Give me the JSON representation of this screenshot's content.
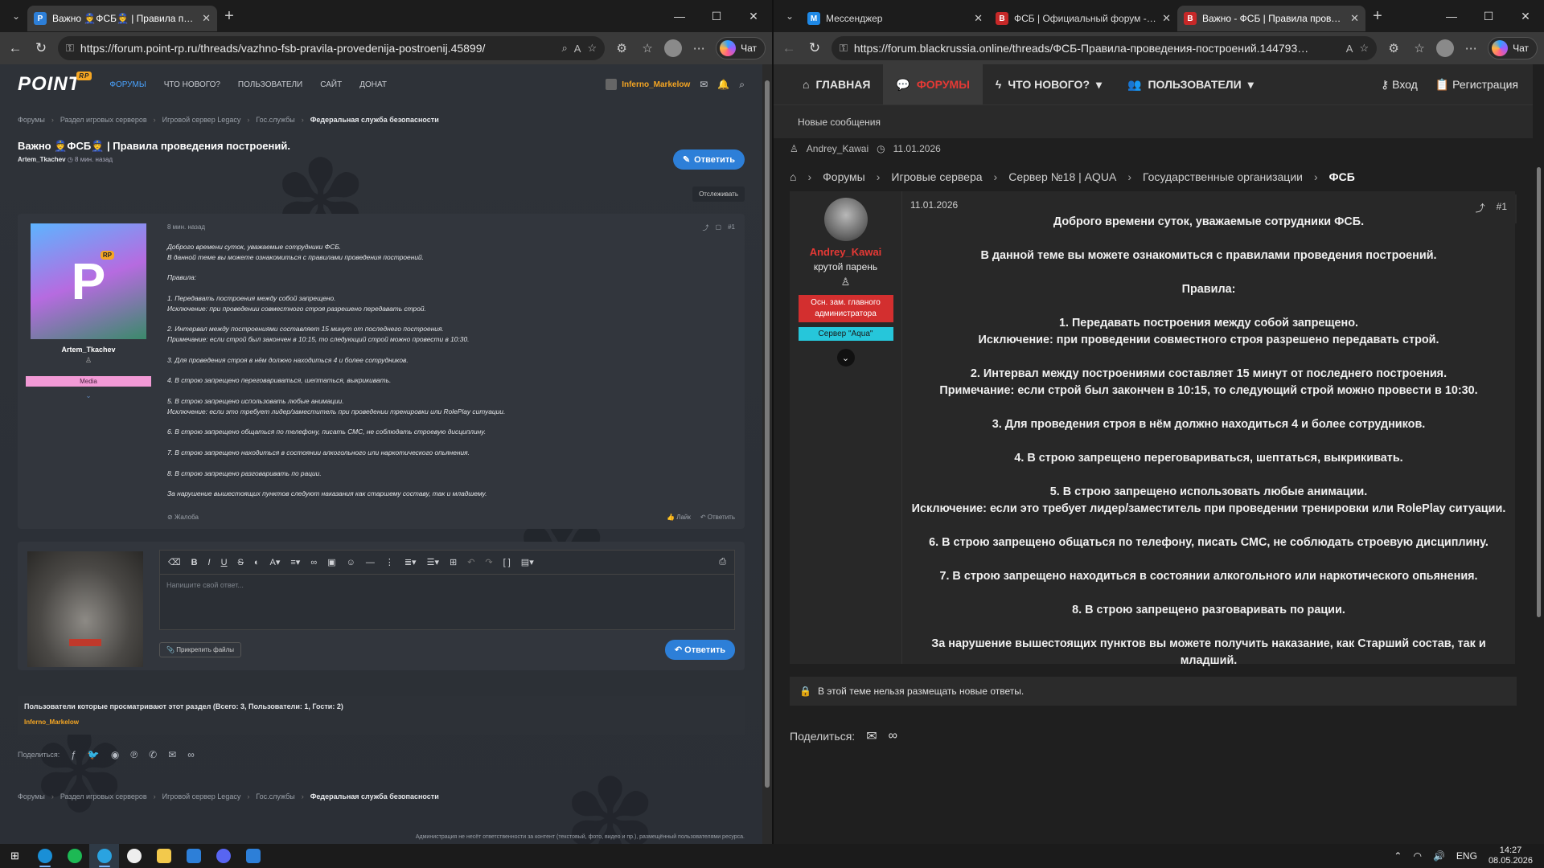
{
  "left_browser": {
    "tabs": [
      {
        "title": "Важно 👮ФСБ👮 | Правила прове…",
        "favicon": "P",
        "color": "#2d7fd8",
        "active": true
      }
    ],
    "new_tab_icon": "plus-icon",
    "url": "https://forum.point-rp.ru/threads/vazhno-fsb-pravila-provedenija-postroenij.45899/",
    "copilot_label": "Чат"
  },
  "left_site": {
    "logo": "POINT",
    "logo_badge": "RP",
    "nav": [
      "ФОРУМЫ",
      "ЧТО НОВОГО?",
      "ПОЛЬЗОВАТЕЛИ",
      "САЙТ",
      "ДОНАТ"
    ],
    "current_user": "Inferno_Markelow",
    "breadcrumbs": [
      "Форумы",
      "Раздел игровых серверов",
      "Игровой сервер Legacy",
      "Гос.службы",
      "Федеральная служба безопасности"
    ],
    "thread_title": "Важно 👮ФСБ👮 | Правила проведения построений.",
    "thread_author": "Artem_Tkachev",
    "thread_time": "8 мин. назад",
    "reply_button": "Ответить",
    "watch_button": "Отслеживать",
    "post": {
      "author": "Artem_Tkachev",
      "avatar_letter": "P",
      "avatar_badge": "RP",
      "badge": "Media",
      "date": "8 мин. назад",
      "number": "#1",
      "lines": [
        "Доброго времени суток, уважаемые сотрудники ФСБ.",
        "В данной теме вы можете ознакомиться с правилами проведения построений.",
        "",
        "Правила:",
        "",
        "1. Передавать построения между собой запрещено.",
        "Исключение: при проведении совместного строя разрешено передавать строй.",
        "",
        "2. Интервал между построениями составляет 15 минут от последнего построения.",
        "Примечание: если строй был закончен в 10:15, то следующий строй можно провести в 10:30.",
        "",
        "3. Для проведения строя в нём должно находиться 4 и более сотрудников.",
        "",
        "4. В строю запрещено переговариваться, шептаться, выкрикивать.",
        "",
        "5. В строю запрещено использовать любые анимации.",
        "Исключение: если это требует лидер/заместитель при проведении тренировки или RolePlay ситуации.",
        "",
        "6. В строю запрещено общаться по телефону, писать СМС, не соблюдать строевую дисциплину.",
        "",
        "7. В строю запрещено находиться в состоянии алкогольного или наркотического опьянения.",
        "",
        "8. В строю запрещено разговаривать по рации.",
        "",
        "За нарушение вышестоящих пунктов следуют наказания как старшему составу, так и младшему."
      ],
      "report": "Жалоба",
      "like": "Лайк",
      "reply": "Ответить"
    },
    "editor": {
      "placeholder": "Напишите свой ответ...",
      "attach": "Прикрепить файлы",
      "submit": "Ответить"
    },
    "viewers_title": "Пользователи которые просматривают этот раздел (Всего: 3, Пользователи: 1, Гости: 2)",
    "viewers_user": "Inferno_Markelow",
    "share_label": "Поделиться:",
    "disclaimer": "Администрация не несёт ответственности за контент (текстовый, фото, видео и пр.), размещённый пользователями ресурса."
  },
  "right_browser": {
    "tabs": [
      {
        "title": "Мессенджер",
        "favicon": "M",
        "color": "#1e88e5",
        "active": false
      },
      {
        "title": "ФСБ | Официальный форум - Bl…",
        "favicon": "B",
        "color": "#c62828",
        "active": false
      },
      {
        "title": "Важно - ФСБ | Правила проведе…",
        "favicon": "B",
        "color": "#c62828",
        "active": true
      }
    ],
    "url": "https://forum.blackrussia.online/threads/ФСБ-Правила-проведения-построений.144793…",
    "copilot_label": "Чат"
  },
  "right_site": {
    "nav": [
      "ГЛАВНАЯ",
      "ФОРУМЫ",
      "ЧТО НОВОГО?",
      "ПОЛЬЗОВАТЕЛИ"
    ],
    "login": "Вход",
    "register": "Регистрация",
    "subnav": "Новые сообщения",
    "thread_author": "Andrey_Kawai",
    "thread_date": "11.01.2026",
    "breadcrumbs": [
      "Форумы",
      "Игровые сервера",
      "Сервер №18 | AQUA",
      "Государственные организации",
      "ФСБ"
    ],
    "locked_notice": "В этой теме нельзя размещать новые ответы.",
    "post": {
      "author": "Andrey_Kawai",
      "user_title": "крутой парень",
      "role1": "Осн. зам. главного администратора",
      "role2": "Сервер \"Aqua\"",
      "date": "11.01.2026",
      "number": "#1",
      "lines": [
        "Доброго времени суток, уважаемые сотрудники ФСБ.",
        "",
        "В данной теме вы можете ознакомиться с правилами проведения построений.",
        "",
        "Правила:",
        "",
        "1. Передавать построения между собой запрещено.",
        "Исключение: при проведении совместного строя разрешено передавать строй.",
        "",
        "2. Интервал между построениями составляет 15 минут от последнего построения.",
        "Примечание: если строй был закончен в 10:15, то следующий строй можно провести в 10:30.",
        "",
        "3. Для проведения строя в нём должно находиться 4 и более сотрудников.",
        "",
        "4. В строю запрещено переговариваться, шептаться, выкрикивать.",
        "",
        "5. В строю запрещено использовать любые анимации.",
        "Исключение: если это требует лидер/заместитель при проведении тренировки или RolePlay ситуации.",
        "",
        "6. В строю запрещено общаться по телефону, писать СМС, не соблюдать строевую дисциплину.",
        "",
        "7. В строю запрещено находиться в состоянии алкогольного или наркотического опьянения.",
        "",
        "8. В строю запрещено разговаривать по рации.",
        "",
        "За нарушение вышестоящих пунктов вы можете получить наказание, как Старший состав, так и",
        "младший."
      ]
    },
    "share_label": "Поделиться:"
  },
  "taskbar": {
    "apps": [
      "windows-start-icon",
      "edge-icon",
      "spotify-icon",
      "telegram-icon",
      "github-icon",
      "file-explorer-icon",
      "point-launcher-icon",
      "discord-icon",
      "point-app-icon"
    ],
    "language": "ENG",
    "time": "14:27",
    "date": "08.05.2026"
  }
}
